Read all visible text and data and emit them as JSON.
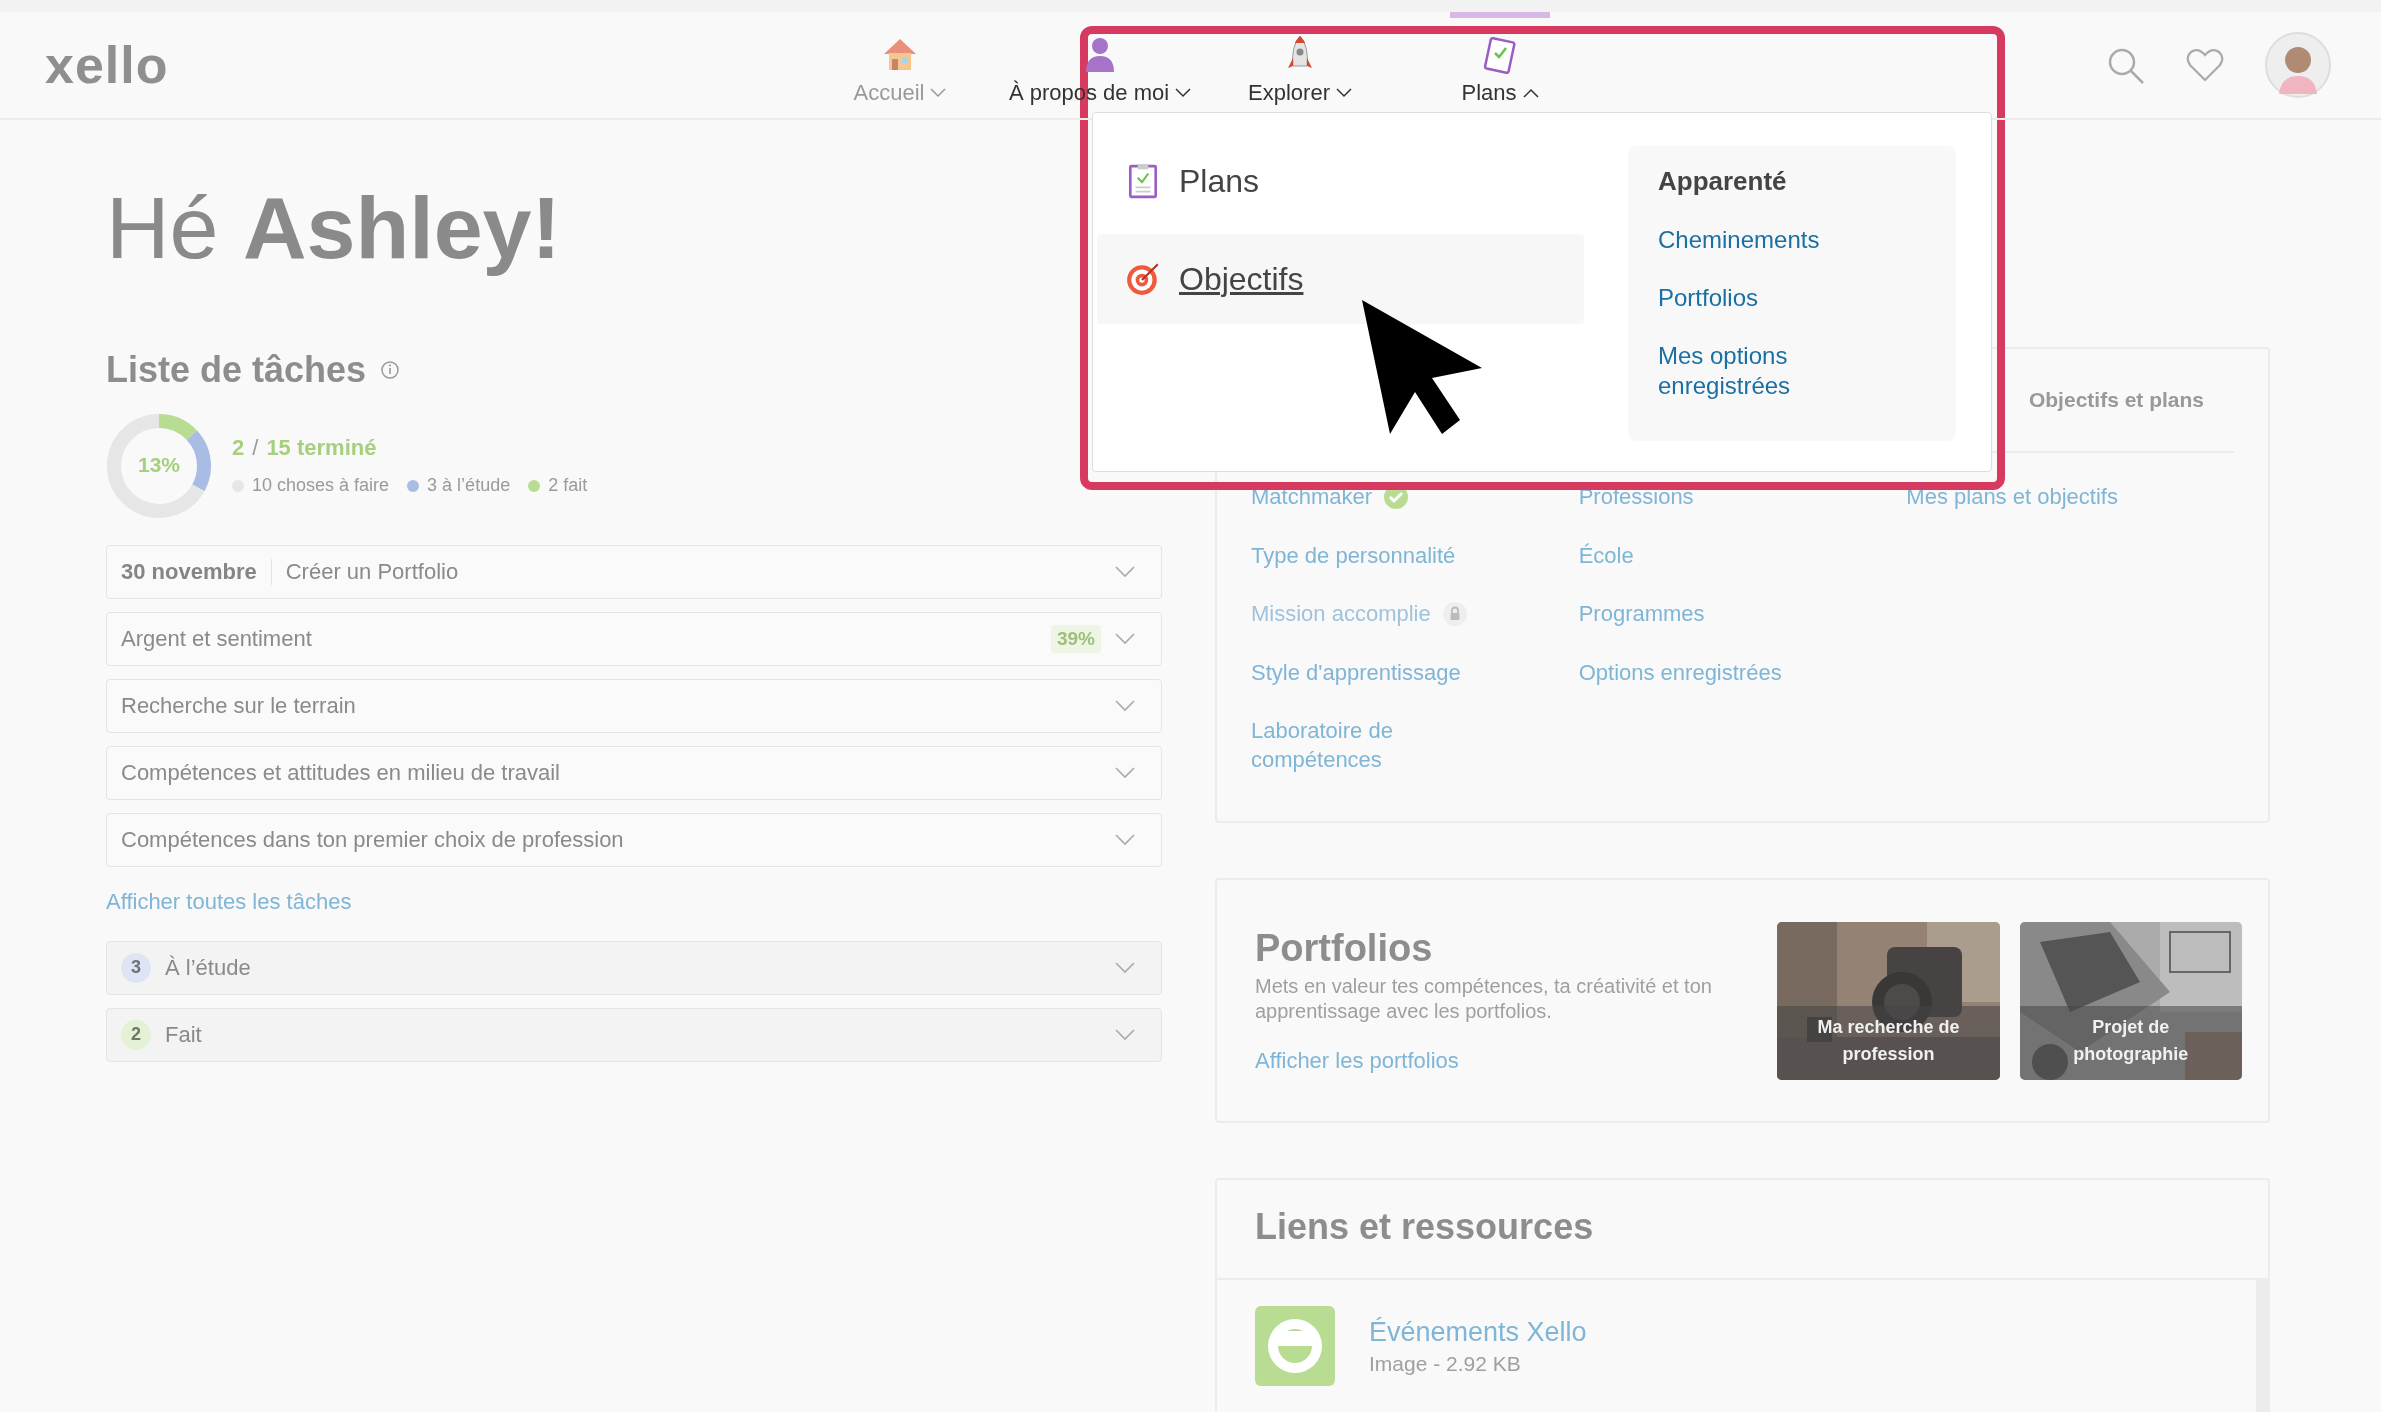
{
  "header": {
    "logo": "xello",
    "nav": [
      {
        "label": "Accueil",
        "expanded": false,
        "selected": false
      },
      {
        "label": "À propos de moi",
        "expanded": false,
        "selected": false
      },
      {
        "label": "Explorer",
        "expanded": false,
        "selected": false
      },
      {
        "label": "Plans",
        "expanded": true,
        "selected": true
      }
    ]
  },
  "dropdown": {
    "items": [
      {
        "label": "Plans",
        "selected": false
      },
      {
        "label": "Objectifs",
        "selected": true
      }
    ],
    "related": {
      "title": "Apparenté",
      "links": [
        "Cheminements",
        "Portfolios",
        "Mes options enregistrées"
      ]
    }
  },
  "greeting": "Hé **Ashley!**",
  "tasks": {
    "title": "Liste de tâches",
    "percent": "13%",
    "done": "2",
    "separator": "/",
    "total": "15 terminé",
    "legend": [
      {
        "label": "10 choses à faire",
        "color": "#e6e6e6",
        "level": 0.67
      },
      {
        "label": "3 à l’étude",
        "color": "#a9bde4",
        "level": 0.2
      },
      {
        "label": "2 fait",
        "color": "#b9dc93",
        "level": 0.13
      }
    ],
    "rows": [
      {
        "date": "30 novembre",
        "label": "Créer un Portfolio"
      },
      {
        "label": "Argent et sentiment",
        "badge": "39%"
      },
      {
        "label": "Recherche sur le terrain"
      },
      {
        "label": "Compétences et attitudes en milieu de travail"
      },
      {
        "label": "Compétences dans ton premier choix de profession"
      }
    ],
    "show_all": "Afficher toutes les tâches",
    "sections": [
      {
        "count": "3",
        "label": "À l’étude",
        "color": "#dde5f5"
      },
      {
        "count": "2",
        "label": "Fait",
        "color": "#e3f1d4"
      }
    ]
  },
  "explore": {
    "tab_label": "Objectifs et plans",
    "columns": [
      {
        "links": [
          {
            "label": "Matchmaker",
            "completed": true,
            "locked": false
          },
          {
            "label": "Type de personnalité",
            "completed": false,
            "locked": false
          },
          {
            "label": "Mission accomplie",
            "completed": false,
            "locked": true
          },
          {
            "label": "Style d'apprentissage",
            "completed": false,
            "locked": false
          },
          {
            "label": "Laboratoire de compétences",
            "completed": false,
            "locked": false
          }
        ]
      },
      {
        "links": [
          {
            "label": "Professions"
          },
          {
            "label": "École"
          },
          {
            "label": "Programmes"
          },
          {
            "label": "Options enregistrées"
          }
        ]
      },
      {
        "links": [
          {
            "label": "Mes plans et objectifs"
          }
        ]
      }
    ]
  },
  "portfolios": {
    "title": "Portfolios",
    "description": "Mets en valeur tes compétences, ta créativité et ton apprentissage avec les portfolios.",
    "link": "Afficher les portfolios",
    "items": [
      {
        "caption": "Ma recherche de profession",
        "kind": "picture"
      },
      {
        "caption": "Projet de photographie",
        "kind": "picture"
      }
    ]
  },
  "resources": {
    "title": "Liens et ressources",
    "items": [
      {
        "title": "Événements Xello",
        "meta": "Image - 2.92 KB"
      }
    ]
  }
}
